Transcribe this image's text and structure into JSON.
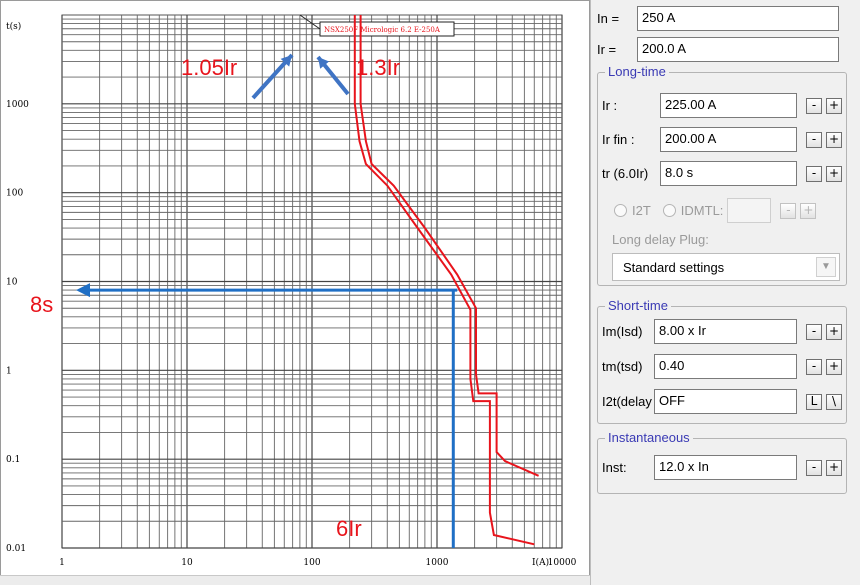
{
  "chart_data": {
    "type": "line",
    "x_scale": "log",
    "y_scale": "log",
    "xlabel": "I(A)",
    "ylabel": "t(s)",
    "x_ticks": [
      "1",
      "10",
      "100",
      "1000",
      "10000"
    ],
    "y_ticks": [
      "1000",
      "100",
      "10",
      "1",
      "0.1",
      "0.01"
    ],
    "xlim": [
      1,
      10000
    ],
    "ylim": [
      0.01,
      10000
    ],
    "grid": true,
    "legend_box": "NSX250F Micrologic 6.2 E-250A",
    "series": [
      {
        "name": "upper curve",
        "color": "#e8141c",
        "points": [
          [
            245,
            10000
          ],
          [
            245,
            1000
          ],
          [
            270,
            380
          ],
          [
            300,
            210
          ],
          [
            450,
            120
          ],
          [
            800,
            40
          ],
          [
            1450,
            12
          ],
          [
            2050,
            5
          ],
          [
            2050,
            0.9
          ],
          [
            2150,
            0.55
          ],
          [
            3000,
            0.55
          ],
          [
            3000,
            0.12
          ],
          [
            3500,
            0.095
          ],
          [
            6500,
            0.065
          ]
        ]
      },
      {
        "name": "lower curve",
        "color": "#e8141c",
        "points": [
          [
            220,
            10000
          ],
          [
            220,
            1000
          ],
          [
            240,
            380
          ],
          [
            270,
            210
          ],
          [
            400,
            120
          ],
          [
            700,
            40
          ],
          [
            1300,
            12
          ],
          [
            1850,
            4.8
          ],
          [
            1850,
            0.8
          ],
          [
            1950,
            0.45
          ],
          [
            2650,
            0.45
          ],
          [
            2650,
            0.025
          ],
          [
            2850,
            0.014
          ],
          [
            6000,
            0.011
          ]
        ]
      }
    ],
    "annotations": [
      {
        "text": "1.05Ir",
        "color": "#e8141c"
      },
      {
        "text": "1.3Ir",
        "color": "#e8141c"
      },
      {
        "text": "8s",
        "color": "#e8141c"
      },
      {
        "text": "6Ir",
        "color": "#e8141c"
      }
    ],
    "markers": [
      {
        "kind": "horizontal-line",
        "y": 8,
        "x_from": 1,
        "x_to": 1450,
        "color": "#1f6fc5"
      },
      {
        "kind": "vertical-line",
        "x": 1350,
        "y_from": 8,
        "y_to": 0.01,
        "color": "#1f6fc5"
      }
    ]
  },
  "panel": {
    "in_label": "In =",
    "in_value": "250 A",
    "ir_label": "Ir =",
    "ir_value": "200.0 A",
    "long_time": {
      "title": "Long-time",
      "ir_label": "Ir :",
      "ir_value": "225.00 A",
      "ir_fin_label": "Ir fin :",
      "ir_fin_value": "200.00 A",
      "tr_label": "tr (6.0Ir)",
      "tr_value": "8.0 s",
      "i2t_label": "I2T",
      "idmtl_label": "IDMTL:",
      "idmtl_value": "",
      "plug_label": "Long delay Plug:",
      "plug_value": "Standard settings"
    },
    "short_time": {
      "title": "Short-time",
      "im_label": "Im(Isd)",
      "im_value": "8.00 x Ir",
      "tm_label": "tm(tsd)",
      "tm_value": "0.40",
      "i2t_label": "I2t(delay",
      "i2t_value": "OFF",
      "l_button": "L",
      "slash_button": "\\"
    },
    "instantaneous": {
      "title": "Instantaneous",
      "inst_label": "Inst:",
      "inst_value": "12.0 x In"
    },
    "minus": "-",
    "plus": "+"
  }
}
